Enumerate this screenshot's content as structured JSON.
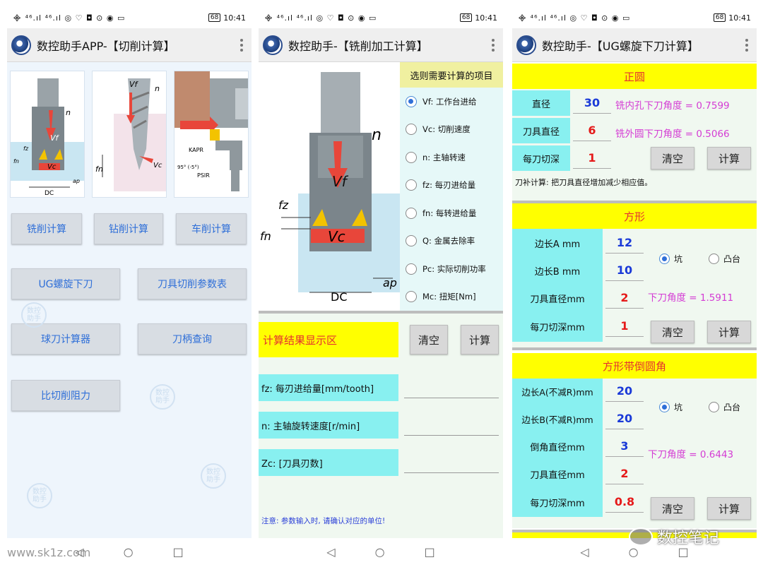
{
  "status": {
    "left": "᯽ ⁴⁶.ıl ⁴⁶.ıl ◎ ♡ ◘ ⊙ ◉ ▭",
    "battery": "68",
    "time": "10:41"
  },
  "screen1": {
    "title": "数控助手APP-【切削计算】",
    "buttons": [
      "铣削计算",
      "钻削计算",
      "车削计算",
      "UG螺旋下刀",
      "刀具切削参数表",
      "球刀计算器",
      "刀柄查询",
      "比切削阻力"
    ],
    "diagram_labels": {
      "n": "n",
      "vf": "Vf",
      "vc": "Vc",
      "dc": "DC",
      "fz": "fz",
      "fn": "fn",
      "ap": "ap",
      "kapr": "KAPR",
      "psir": "PSIR",
      "angle": "95° (-5°)"
    },
    "watermark": "数控 助手",
    "url": "www.sk1z.com"
  },
  "screen2": {
    "title": "数控助手-【铣削加工计算】",
    "select_header": "选则需要计算的项目",
    "options": [
      {
        "label": "Vf: 工作台进给",
        "selected": true
      },
      {
        "label": "Vc: 切削速度",
        "selected": false
      },
      {
        "label": "n: 主轴转速",
        "selected": false
      },
      {
        "label": "fz: 每刃进给量",
        "selected": false
      },
      {
        "label": "fn: 每转进给量",
        "selected": false
      },
      {
        "label": "Q: 金属去除率",
        "selected": false
      },
      {
        "label": "Pc: 实际切削功率",
        "selected": false
      },
      {
        "label": "Mc: 扭矩[Nm]",
        "selected": false
      }
    ],
    "result_header": "计算结果显示区",
    "clear": "清空",
    "calc": "计算",
    "fields": [
      "fz: 每刃进给量[mm/tooth]",
      "n: 主轴旋转速度[r/min]",
      "Zc: [刀具刃数]"
    ],
    "note": "注意: 参数输入时, 请确认对应的单位!",
    "diagram_labels": {
      "n": "n",
      "vf": "Vf",
      "vc": "Vc",
      "dc": "DC",
      "fz": "fz",
      "fn": "fn",
      "ap": "ap"
    }
  },
  "screen3": {
    "title": "数控助手-【UG螺旋下刀计算】",
    "circle": {
      "header": "正圆",
      "rows": [
        {
          "label": "直径",
          "value": "30"
        },
        {
          "label": "刀具直径",
          "value": "6"
        },
        {
          "label": "每刀切深",
          "value": "1"
        }
      ],
      "results": [
        "铣内孔下刀角度 = 0.7599",
        "铣外圆下刀角度 = 0.5066"
      ],
      "tip": "刀补计算: 把刀具直径增加减少相应值。"
    },
    "square": {
      "header": "方形",
      "rows": [
        {
          "label": "边长A mm",
          "value": "12"
        },
        {
          "label": "边长B mm",
          "value": "10"
        },
        {
          "label": "刀具直径mm",
          "value": "2"
        },
        {
          "label": "每刀切深mm",
          "value": "1"
        }
      ],
      "radio": [
        "坑",
        "凸台"
      ],
      "result": "下刀角度 = 1.5911"
    },
    "chamfer": {
      "header": "方形带倒圆角",
      "rows": [
        {
          "label": "边长A(不减R)mm",
          "value": "20"
        },
        {
          "label": "边长B(不减R)mm",
          "value": "20"
        },
        {
          "label": "倒角直径mm",
          "value": "3"
        },
        {
          "label": "刀具直径mm",
          "value": "2"
        },
        {
          "label": "每刀切深mm",
          "value": "0.8"
        }
      ],
      "radio": [
        "坑",
        "凸台"
      ],
      "result": "下刀角度 = 0.6443"
    },
    "clear": "清空",
    "calc": "计算",
    "brand": "数控笔记"
  },
  "nav": {
    "back": "◁",
    "home": "○",
    "recent": "□"
  }
}
